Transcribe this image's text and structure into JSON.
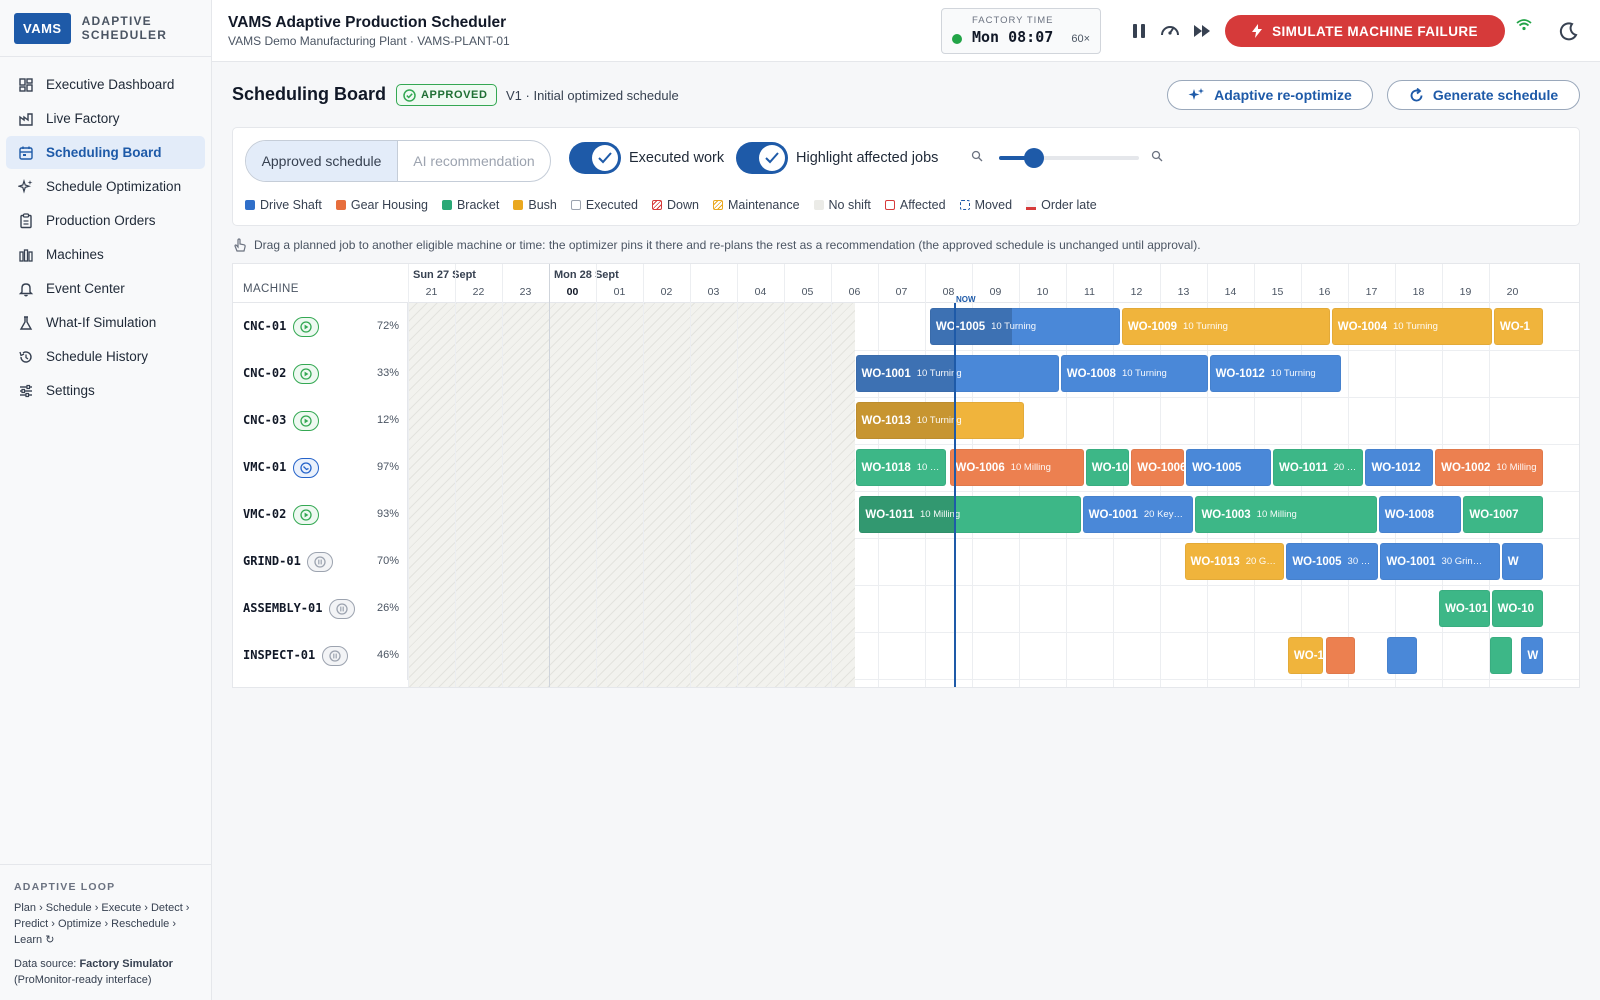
{
  "brand": {
    "logo": "VAMS",
    "line1": "ADAPTIVE",
    "line2": "SCHEDULER"
  },
  "nav": [
    {
      "label": "Executive Dashboard",
      "icon": "dashboard-icon",
      "active": false
    },
    {
      "label": "Live Factory",
      "icon": "factory-icon",
      "active": false
    },
    {
      "label": "Scheduling Board",
      "icon": "calendar-icon",
      "active": true
    },
    {
      "label": "Schedule Optimization",
      "icon": "sparkle-icon",
      "active": false
    },
    {
      "label": "Production Orders",
      "icon": "clipboard-icon",
      "active": false
    },
    {
      "label": "Machines",
      "icon": "machines-icon",
      "active": false
    },
    {
      "label": "Event Center",
      "icon": "bell-icon",
      "active": false
    },
    {
      "label": "What-If Simulation",
      "icon": "flask-icon",
      "active": false
    },
    {
      "label": "Schedule History",
      "icon": "history-icon",
      "active": false
    },
    {
      "label": "Settings",
      "icon": "sliders-icon",
      "active": false
    }
  ],
  "footer": {
    "label": "ADAPTIVE LOOP",
    "loop": "Plan › Schedule › Execute › Detect › Predict › Optimize › Reschedule › Learn ↻",
    "source_label": "Data source:",
    "source_name": "Factory Simulator",
    "source_note": "(ProMonitor-ready interface)"
  },
  "header": {
    "title": "VAMS Adaptive Production Scheduler",
    "subtitle": "VAMS Demo Manufacturing Plant · VAMS-PLANT-01",
    "clock_label": "FACTORY TIME",
    "clock_time": "Mon 08:07",
    "clock_speed": "60×",
    "fail_button": "SIMULATE MACHINE FAILURE"
  },
  "board": {
    "title": "Scheduling Board",
    "status": "APPROVED",
    "version": "V1 · Initial optimized schedule",
    "reoptimize": "Adaptive re-optimize",
    "generate": "Generate schedule",
    "seg_approved": "Approved schedule",
    "seg_ai": "AI recommendation",
    "toggle_executed": "Executed work",
    "toggle_highlight": "Highlight affected jobs",
    "zoom_level": 0.25,
    "hint": "Drag a planned job to another eligible machine or time: the optimizer pins it there and re-plans the rest as a recommendation (the approved schedule is unchanged until approval)."
  },
  "legend": {
    "drive_shaft": "Drive Shaft",
    "gear_housing": "Gear Housing",
    "bracket": "Bracket",
    "bush": "Bush",
    "executed": "Executed",
    "down": "Down",
    "maintenance": "Maintenance",
    "no_shift": "No shift",
    "affected": "Affected",
    "moved": "Moved",
    "order_late": "Order late"
  },
  "colors": {
    "drive_shaft": "#4a88d8",
    "gear_housing": "#ec8050",
    "bracket": "#3db787",
    "bush": "#f0b43c",
    "accent": "#1e5aa8",
    "danger": "#d63a3a"
  },
  "timeline": {
    "machine_header": "MACHINE",
    "day1": "Sun 27 Sept",
    "day2": "Mon 28 Sept",
    "hours": [
      "21",
      "22",
      "23",
      "00",
      "01",
      "02",
      "03",
      "04",
      "05",
      "06",
      "07",
      "08",
      "09",
      "10",
      "11",
      "12",
      "13",
      "14",
      "15",
      "16",
      "17",
      "18",
      "19",
      "20"
    ],
    "now_label": "NOW"
  },
  "machines": [
    {
      "name": "CNC-01",
      "status": "run",
      "util": "72%"
    },
    {
      "name": "CNC-02",
      "status": "run",
      "util": "33%"
    },
    {
      "name": "CNC-03",
      "status": "run",
      "util": "12%"
    },
    {
      "name": "VMC-01",
      "status": "busy",
      "util": "97%"
    },
    {
      "name": "VMC-02",
      "status": "run",
      "util": "93%"
    },
    {
      "name": "GRIND-01",
      "status": "idle",
      "util": "70%"
    },
    {
      "name": "ASSEMBLY-01",
      "status": "idle",
      "util": "26%"
    },
    {
      "name": "INSPECT-01",
      "status": "idle",
      "util": "46%"
    }
  ],
  "jobs": [
    {
      "row": 0,
      "start": "07:35",
      "end": "11:40",
      "product": "drive_shaft",
      "wo": "WO-1005",
      "op": "10 Turning",
      "exec_until": "09:20"
    },
    {
      "row": 0,
      "start": "11:40",
      "end": "16:08",
      "product": "bush",
      "wo": "WO-1009",
      "op": "10 Turning"
    },
    {
      "row": 0,
      "start": "16:08",
      "end": "19:35",
      "product": "bush",
      "wo": "WO-1004",
      "op": "10 Turning"
    },
    {
      "row": 0,
      "start": "19:35",
      "end": "20:40",
      "product": "bush",
      "wo": "WO-1",
      "op": ""
    },
    {
      "row": 1,
      "start": "06:00",
      "end": "10:22",
      "product": "drive_shaft",
      "wo": "WO-1001",
      "op": "10 Turning",
      "exec_until": "08:07"
    },
    {
      "row": 1,
      "start": "10:22",
      "end": "13:32",
      "product": "drive_shaft",
      "wo": "WO-1008",
      "op": "10 Turning"
    },
    {
      "row": 1,
      "start": "13:32",
      "end": "16:22",
      "product": "drive_shaft",
      "wo": "WO-1012",
      "op": "10 Turning"
    },
    {
      "row": 2,
      "start": "06:00",
      "end": "09:38",
      "product": "bush",
      "wo": "WO-1013",
      "op": "10 Turning",
      "exec_until": "08:07"
    },
    {
      "row": 3,
      "start": "06:00",
      "end": "07:58",
      "product": "bracket",
      "wo": "WO-1018",
      "op": "10 …"
    },
    {
      "row": 3,
      "start": "08:00",
      "end": "10:54",
      "product": "gear_housing",
      "wo": "WO-1006",
      "op": "10 Milling"
    },
    {
      "row": 3,
      "start": "10:54",
      "end": "11:52",
      "product": "bracket",
      "wo": "WO-10",
      "op": ""
    },
    {
      "row": 3,
      "start": "11:52",
      "end": "13:02",
      "product": "gear_housing",
      "wo": "WO-1006",
      "op": ""
    },
    {
      "row": 3,
      "start": "13:02",
      "end": "14:53",
      "product": "drive_shaft",
      "wo": "WO-1005",
      "op": ""
    },
    {
      "row": 3,
      "start": "14:53",
      "end": "16:51",
      "product": "bracket",
      "wo": "WO-1011",
      "op": "20 …"
    },
    {
      "row": 3,
      "start": "16:51",
      "end": "18:20",
      "product": "drive_shaft",
      "wo": "WO-1012",
      "op": ""
    },
    {
      "row": 3,
      "start": "18:20",
      "end": "20:40",
      "product": "gear_housing",
      "wo": "WO-1002",
      "op": "10 Milling"
    },
    {
      "row": 4,
      "start": "06:05",
      "end": "10:50",
      "product": "bracket",
      "wo": "WO-1011",
      "op": "10 Milling",
      "exec_until": "08:07"
    },
    {
      "row": 4,
      "start": "10:50",
      "end": "13:14",
      "product": "drive_shaft",
      "wo": "WO-1001",
      "op": "20 Key…"
    },
    {
      "row": 4,
      "start": "13:14",
      "end": "17:08",
      "product": "bracket",
      "wo": "WO-1003",
      "op": "10 Milling"
    },
    {
      "row": 4,
      "start": "17:08",
      "end": "18:56",
      "product": "drive_shaft",
      "wo": "WO-1008",
      "op": ""
    },
    {
      "row": 4,
      "start": "18:56",
      "end": "20:40",
      "product": "bracket",
      "wo": "WO-1007",
      "op": ""
    },
    {
      "row": 5,
      "start": "13:00",
      "end": "15:10",
      "product": "bush",
      "wo": "WO-1013",
      "op": "20 G…"
    },
    {
      "row": 5,
      "start": "15:10",
      "end": "17:10",
      "product": "drive_shaft",
      "wo": "WO-1005",
      "op": "30 …"
    },
    {
      "row": 5,
      "start": "17:10",
      "end": "19:45",
      "product": "drive_shaft",
      "wo": "WO-1001",
      "op": "30 Grin…"
    },
    {
      "row": 5,
      "start": "19:45",
      "end": "20:40",
      "product": "drive_shaft",
      "wo": "W",
      "op": ""
    },
    {
      "row": 6,
      "start": "18:25",
      "end": "19:32",
      "product": "bracket",
      "wo": "WO-101",
      "op": ""
    },
    {
      "row": 6,
      "start": "19:32",
      "end": "20:40",
      "product": "bracket",
      "wo": "WO-10",
      "op": ""
    },
    {
      "row": 7,
      "start": "15:12",
      "end": "16:00",
      "product": "bush",
      "wo": "WO-1",
      "op": ""
    },
    {
      "row": 7,
      "start": "16:00",
      "end": "16:40",
      "product": "gear_housing",
      "wo": "",
      "op": ""
    },
    {
      "row": 7,
      "start": "17:18",
      "end": "18:00",
      "product": "drive_shaft",
      "wo": "",
      "op": ""
    },
    {
      "row": 7,
      "start": "19:30",
      "end": "20:00",
      "product": "bracket",
      "wo": "",
      "op": ""
    },
    {
      "row": 7,
      "start": "20:10",
      "end": "20:40",
      "product": "drive_shaft",
      "wo": "W",
      "op": ""
    }
  ]
}
